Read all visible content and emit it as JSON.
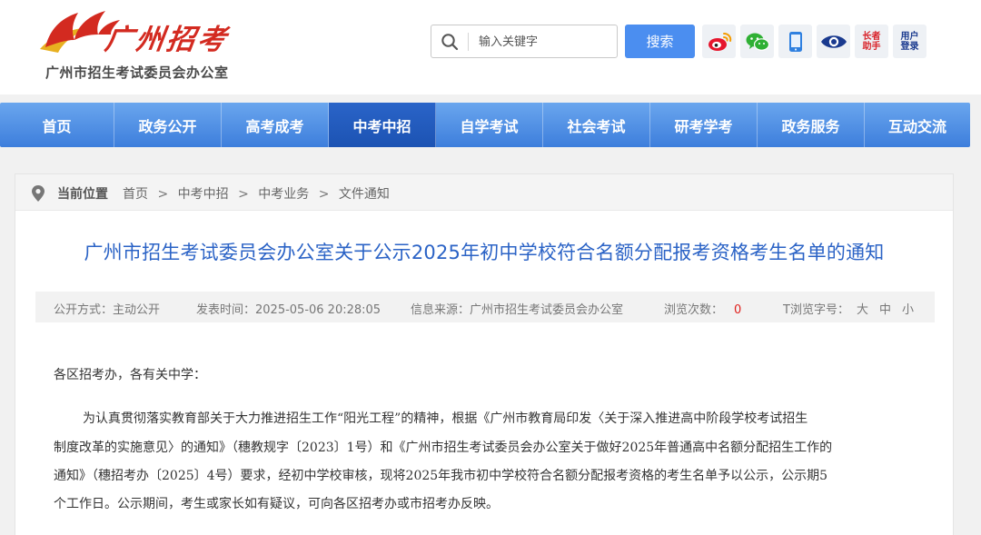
{
  "header": {
    "logo_script": "广州招考",
    "logo_subtitle": "广州市招生考试委员会办公室",
    "search": {
      "placeholder": "输入关键字"
    },
    "search_button": "搜索",
    "tools": {
      "elder_line1": "长者",
      "elder_line2": "助手",
      "user_line1": "用户",
      "user_line2": "登录"
    },
    "colors": {
      "brand_red": "#d32a20",
      "button_blue": "#4b8ef0"
    }
  },
  "nav": {
    "items": [
      {
        "label": "首页"
      },
      {
        "label": "政务公开"
      },
      {
        "label": "高考成考"
      },
      {
        "label": "中考中招"
      },
      {
        "label": "自学考试"
      },
      {
        "label": "社会考试"
      },
      {
        "label": "研考学考"
      },
      {
        "label": "政务服务"
      },
      {
        "label": "互动交流"
      }
    ],
    "active_index": 3
  },
  "breadcrumb": {
    "label": "当前位置",
    "items": [
      "首页",
      "中考中招",
      "中考业务",
      "文件通知"
    ],
    "separator": ">"
  },
  "article": {
    "title": "广州市招生考试委员会办公室关于公示2025年初中学校符合名额分配报考资格考生名单的通知",
    "meta": {
      "disclosure": "公开方式：主动公开",
      "published": "发表时间：2025-05-06 20:28:05",
      "source": "信息来源：广州市招生考试委员会办公室",
      "views_label": "浏览次数：",
      "views_count": "0",
      "font_label": "T浏览字号：",
      "font_large": "大",
      "font_medium": "中",
      "font_small": "小"
    },
    "salutation": "各区招考办，各有关中学：",
    "paragraph_lines": [
      "为认真贯彻落实教育部关于大力推进招生工作“阳光工程”的精神，根据《广州市教育局印发〈关于深入推进高中阶段学校考试招生",
      "制度改革的实施意见〉的通知》（穗教规字〔2023〕1号）和《广州市招生考试委员会办公室关于做好2025年普通高中名额分配招生工作的",
      "通知》（穗招考办〔2025〕4号）要求，经初中学校审核，现将2025年我市初中学校符合名额分配报考资格的考生名单予以公示，公示期5",
      "个工作日。公示期间，考生或家长如有疑议，可向各区招考办或市招考办反映。"
    ]
  }
}
